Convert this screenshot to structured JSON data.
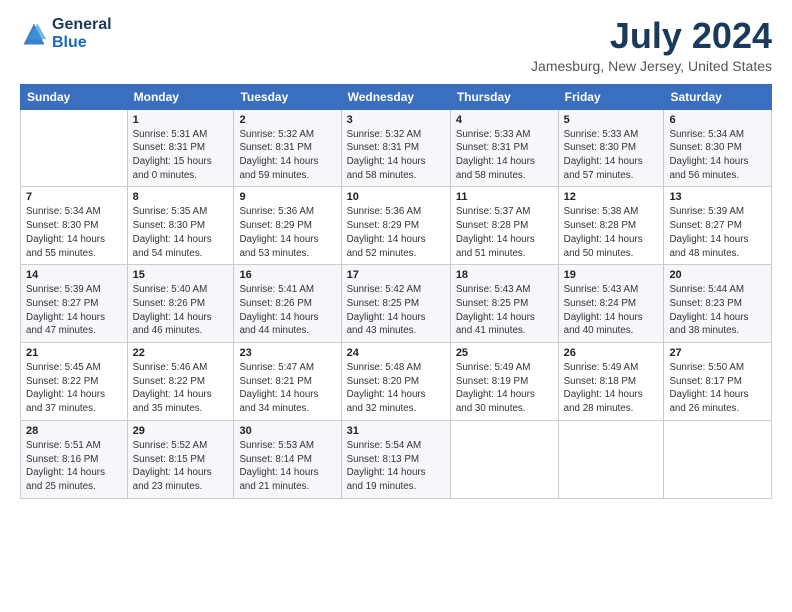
{
  "logo": {
    "general": "General",
    "blue": "Blue"
  },
  "header": {
    "month": "July 2024",
    "location": "Jamesburg, New Jersey, United States"
  },
  "days_of_week": [
    "Sunday",
    "Monday",
    "Tuesday",
    "Wednesday",
    "Thursday",
    "Friday",
    "Saturday"
  ],
  "weeks": [
    [
      {
        "day": "",
        "info": ""
      },
      {
        "day": "1",
        "info": "Sunrise: 5:31 AM\nSunset: 8:31 PM\nDaylight: 15 hours\nand 0 minutes."
      },
      {
        "day": "2",
        "info": "Sunrise: 5:32 AM\nSunset: 8:31 PM\nDaylight: 14 hours\nand 59 minutes."
      },
      {
        "day": "3",
        "info": "Sunrise: 5:32 AM\nSunset: 8:31 PM\nDaylight: 14 hours\nand 58 minutes."
      },
      {
        "day": "4",
        "info": "Sunrise: 5:33 AM\nSunset: 8:31 PM\nDaylight: 14 hours\nand 58 minutes."
      },
      {
        "day": "5",
        "info": "Sunrise: 5:33 AM\nSunset: 8:30 PM\nDaylight: 14 hours\nand 57 minutes."
      },
      {
        "day": "6",
        "info": "Sunrise: 5:34 AM\nSunset: 8:30 PM\nDaylight: 14 hours\nand 56 minutes."
      }
    ],
    [
      {
        "day": "7",
        "info": "Sunrise: 5:34 AM\nSunset: 8:30 PM\nDaylight: 14 hours\nand 55 minutes."
      },
      {
        "day": "8",
        "info": "Sunrise: 5:35 AM\nSunset: 8:30 PM\nDaylight: 14 hours\nand 54 minutes."
      },
      {
        "day": "9",
        "info": "Sunrise: 5:36 AM\nSunset: 8:29 PM\nDaylight: 14 hours\nand 53 minutes."
      },
      {
        "day": "10",
        "info": "Sunrise: 5:36 AM\nSunset: 8:29 PM\nDaylight: 14 hours\nand 52 minutes."
      },
      {
        "day": "11",
        "info": "Sunrise: 5:37 AM\nSunset: 8:28 PM\nDaylight: 14 hours\nand 51 minutes."
      },
      {
        "day": "12",
        "info": "Sunrise: 5:38 AM\nSunset: 8:28 PM\nDaylight: 14 hours\nand 50 minutes."
      },
      {
        "day": "13",
        "info": "Sunrise: 5:39 AM\nSunset: 8:27 PM\nDaylight: 14 hours\nand 48 minutes."
      }
    ],
    [
      {
        "day": "14",
        "info": "Sunrise: 5:39 AM\nSunset: 8:27 PM\nDaylight: 14 hours\nand 47 minutes."
      },
      {
        "day": "15",
        "info": "Sunrise: 5:40 AM\nSunset: 8:26 PM\nDaylight: 14 hours\nand 46 minutes."
      },
      {
        "day": "16",
        "info": "Sunrise: 5:41 AM\nSunset: 8:26 PM\nDaylight: 14 hours\nand 44 minutes."
      },
      {
        "day": "17",
        "info": "Sunrise: 5:42 AM\nSunset: 8:25 PM\nDaylight: 14 hours\nand 43 minutes."
      },
      {
        "day": "18",
        "info": "Sunrise: 5:43 AM\nSunset: 8:25 PM\nDaylight: 14 hours\nand 41 minutes."
      },
      {
        "day": "19",
        "info": "Sunrise: 5:43 AM\nSunset: 8:24 PM\nDaylight: 14 hours\nand 40 minutes."
      },
      {
        "day": "20",
        "info": "Sunrise: 5:44 AM\nSunset: 8:23 PM\nDaylight: 14 hours\nand 38 minutes."
      }
    ],
    [
      {
        "day": "21",
        "info": "Sunrise: 5:45 AM\nSunset: 8:22 PM\nDaylight: 14 hours\nand 37 minutes."
      },
      {
        "day": "22",
        "info": "Sunrise: 5:46 AM\nSunset: 8:22 PM\nDaylight: 14 hours\nand 35 minutes."
      },
      {
        "day": "23",
        "info": "Sunrise: 5:47 AM\nSunset: 8:21 PM\nDaylight: 14 hours\nand 34 minutes."
      },
      {
        "day": "24",
        "info": "Sunrise: 5:48 AM\nSunset: 8:20 PM\nDaylight: 14 hours\nand 32 minutes."
      },
      {
        "day": "25",
        "info": "Sunrise: 5:49 AM\nSunset: 8:19 PM\nDaylight: 14 hours\nand 30 minutes."
      },
      {
        "day": "26",
        "info": "Sunrise: 5:49 AM\nSunset: 8:18 PM\nDaylight: 14 hours\nand 28 minutes."
      },
      {
        "day": "27",
        "info": "Sunrise: 5:50 AM\nSunset: 8:17 PM\nDaylight: 14 hours\nand 26 minutes."
      }
    ],
    [
      {
        "day": "28",
        "info": "Sunrise: 5:51 AM\nSunset: 8:16 PM\nDaylight: 14 hours\nand 25 minutes."
      },
      {
        "day": "29",
        "info": "Sunrise: 5:52 AM\nSunset: 8:15 PM\nDaylight: 14 hours\nand 23 minutes."
      },
      {
        "day": "30",
        "info": "Sunrise: 5:53 AM\nSunset: 8:14 PM\nDaylight: 14 hours\nand 21 minutes."
      },
      {
        "day": "31",
        "info": "Sunrise: 5:54 AM\nSunset: 8:13 PM\nDaylight: 14 hours\nand 19 minutes."
      },
      {
        "day": "",
        "info": ""
      },
      {
        "day": "",
        "info": ""
      },
      {
        "day": "",
        "info": ""
      }
    ]
  ]
}
